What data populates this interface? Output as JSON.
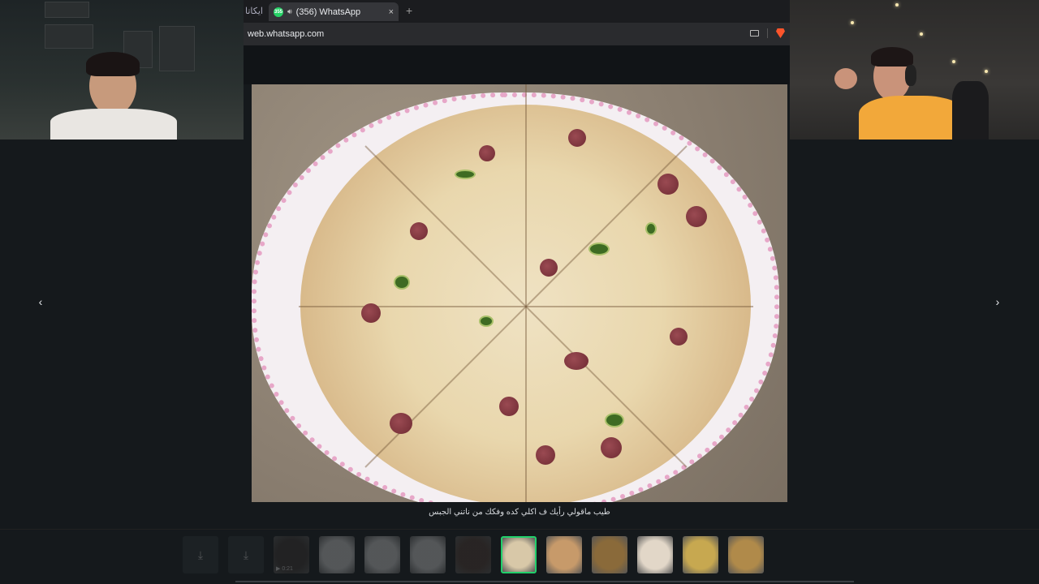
{
  "browser": {
    "prev_tab_label": "ايكاتا",
    "tab": {
      "title": "(356) WhatsApp",
      "favicon_text": "355",
      "close_label": "×"
    },
    "new_tab_label": "+",
    "url": "web.whatsapp.com"
  },
  "viewer": {
    "prev_label": "‹",
    "next_label": "›",
    "caption": "طيب ماقولي رأيك ف اكلي كده وفكك من ناتني الجبس"
  },
  "thumbnails": [
    {
      "kind": "download",
      "icon": "download-icon",
      "icon_glyph": "⤓",
      "dim": true
    },
    {
      "kind": "download",
      "icon": "download-icon",
      "icon_glyph": "⤓",
      "dim": true
    },
    {
      "kind": "video",
      "duration": "0:21",
      "dim": true,
      "color": "#3a3330"
    },
    {
      "kind": "document",
      "dim": true,
      "color": "#c9c9c9"
    },
    {
      "kind": "document",
      "dim": true,
      "color": "#c9c9c9"
    },
    {
      "kind": "document",
      "dim": true,
      "color": "#c9c9c9"
    },
    {
      "kind": "photo",
      "dim": true,
      "color": "#4d3a32"
    },
    {
      "kind": "photo",
      "active": true,
      "color": "#d8c8a8"
    },
    {
      "kind": "photo",
      "color": "#c79a6a"
    },
    {
      "kind": "photo",
      "color": "#8a6a3a"
    },
    {
      "kind": "photo",
      "color": "#e2d7c8"
    },
    {
      "kind": "photo",
      "color": "#c7a850"
    },
    {
      "kind": "photo",
      "color": "#b08a4a"
    }
  ]
}
